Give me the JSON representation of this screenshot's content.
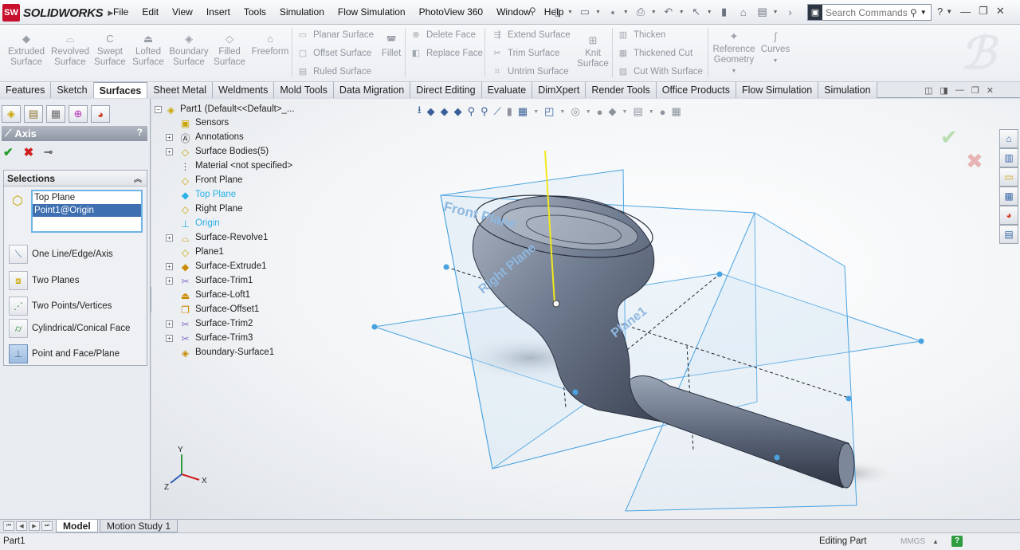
{
  "app": {
    "logo_badge": "SW",
    "logo_text": "SOLIDWORKS",
    "menus": [
      "File",
      "Edit",
      "View",
      "Insert",
      "Tools",
      "Simulation",
      "Flow Simulation",
      "PhotoView 360",
      "Window",
      "Help"
    ],
    "search_placeholder": "Search Commands"
  },
  "ribbon": {
    "large_buttons": [
      {
        "line1": "Extruded",
        "line2": "Surface"
      },
      {
        "line1": "Revolved",
        "line2": "Surface"
      },
      {
        "line1": "Swept",
        "line2": "Surface"
      },
      {
        "line1": "Lofted",
        "line2": "Surface"
      },
      {
        "line1": "Boundary",
        "line2": "Surface"
      },
      {
        "line1": "Filled",
        "line2": "Surface"
      },
      {
        "line1": "Freeform",
        "line2": ""
      }
    ],
    "planar_surface": "Planar Surface",
    "offset_surface": "Offset Surface",
    "ruled_surface": "Ruled Surface",
    "fillet": "Fillet",
    "delete_face": "Delete Face",
    "replace_face": "Replace Face",
    "extend_surface": "Extend Surface",
    "trim_surface": "Trim Surface",
    "untrim_surface": "Untrim Surface",
    "knit_surface_1": "Knit",
    "knit_surface_2": "Surface",
    "thicken": "Thicken",
    "thickened_cut": "Thickened Cut",
    "cut_with_surface": "Cut With Surface",
    "reference_geometry_1": "Reference",
    "reference_geometry_2": "Geometry",
    "curves": "Curves"
  },
  "tabs": [
    "Features",
    "Sketch",
    "Surfaces",
    "Sheet Metal",
    "Weldments",
    "Mold Tools",
    "Data Migration",
    "Direct Editing",
    "Evaluate",
    "DimXpert",
    "Render Tools",
    "Office Products",
    "Flow Simulation",
    "Simulation"
  ],
  "active_tab": "Surfaces",
  "property_manager": {
    "title": "Axis",
    "help": "?",
    "selections_header": "Selections",
    "selected_items": [
      "Top Plane",
      "Point1@Origin"
    ],
    "options": [
      "One Line/Edge/Axis",
      "Two Planes",
      "Two Points/Vertices",
      "Cylindrical/Conical Face",
      "Point and Face/Plane"
    ]
  },
  "tree": {
    "root": "Part1  (Default<<Default>_...",
    "items": [
      {
        "label": "Sensors",
        "icon": "sensor-icon",
        "expand": false
      },
      {
        "label": "Annotations",
        "icon": "annotation-icon",
        "expand": true
      },
      {
        "label": "Surface Bodies(5)",
        "icon": "surface-bodies-icon",
        "expand": true
      },
      {
        "label": "Material <not specified>",
        "icon": "material-icon",
        "expand": false
      },
      {
        "label": "Front Plane",
        "icon": "plane-icon",
        "expand": false
      },
      {
        "label": "Top Plane",
        "icon": "plane-icon",
        "expand": false,
        "highlighted": true
      },
      {
        "label": "Right Plane",
        "icon": "plane-icon",
        "expand": false
      },
      {
        "label": "Origin",
        "icon": "origin-icon",
        "expand": false,
        "highlighted": true
      },
      {
        "label": "Surface-Revolve1",
        "icon": "revolve-icon",
        "expand": true
      },
      {
        "label": "Plane1",
        "icon": "plane-icon",
        "expand": false
      },
      {
        "label": "Surface-Extrude1",
        "icon": "extrude-icon",
        "expand": true
      },
      {
        "label": "Surface-Trim1",
        "icon": "trim-icon",
        "expand": true
      },
      {
        "label": "Surface-Loft1",
        "icon": "loft-icon",
        "expand": false
      },
      {
        "label": "Surface-Offset1",
        "icon": "offset-icon",
        "expand": false
      },
      {
        "label": "Surface-Trim2",
        "icon": "trim-icon",
        "expand": true
      },
      {
        "label": "Surface-Trim3",
        "icon": "trim-icon",
        "expand": true
      },
      {
        "label": "Boundary-Surface1",
        "icon": "boundary-icon",
        "expand": false
      }
    ]
  },
  "viewport": {
    "plane_labels": [
      "Front Plane",
      "Right Plane",
      "Plane1"
    ],
    "triad": {
      "x": "X",
      "y": "Y",
      "z": "Z"
    }
  },
  "bottom_tabs": [
    "Model",
    "Motion Study 1"
  ],
  "status": {
    "left": "Part1",
    "mode": "Editing Part",
    "units": "MMGS"
  },
  "colors": {
    "accent": "#3e6fb0",
    "highlight_text": "#2bb0e6",
    "plane_edge": "#4aa3e0",
    "ok_green": "#1f9e2c",
    "cancel_red": "#d11f1f"
  }
}
